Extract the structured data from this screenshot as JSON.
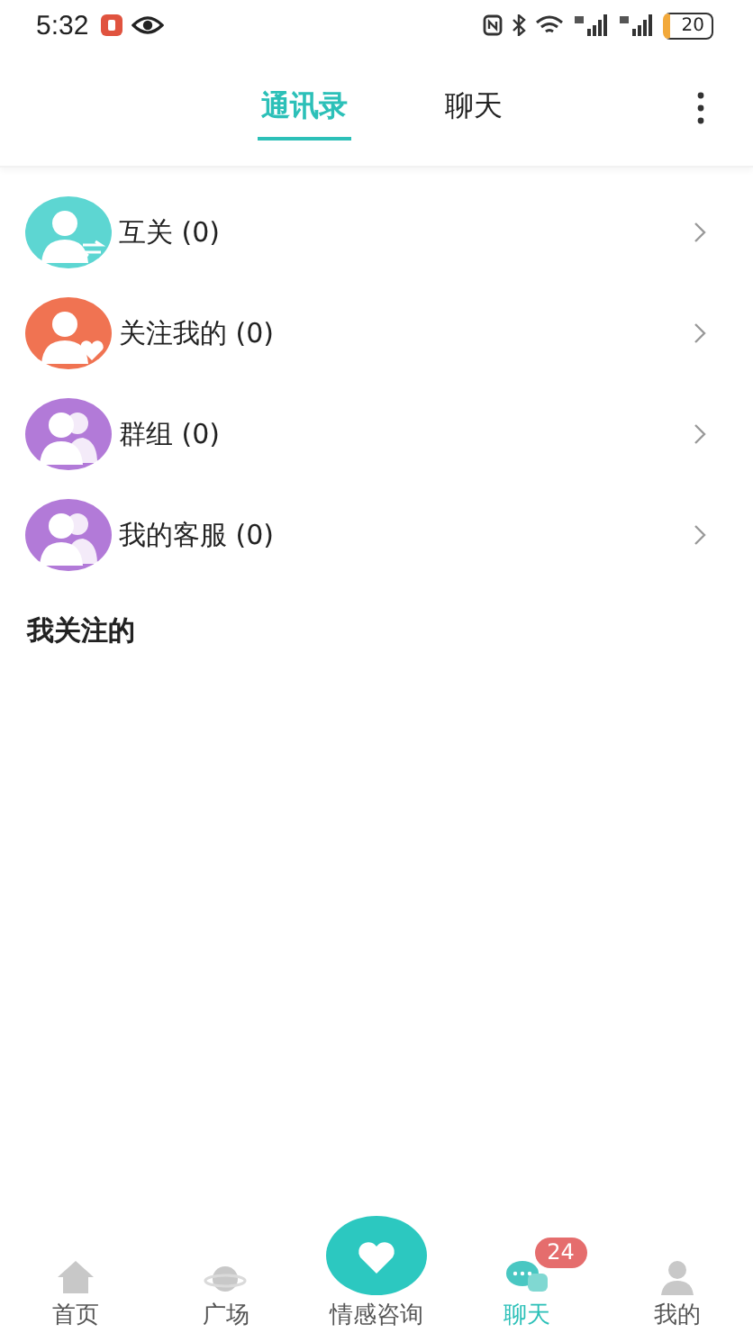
{
  "status_bar": {
    "time": "5:32",
    "battery": "20"
  },
  "tabs": [
    {
      "label": "通讯录",
      "selected": true
    },
    {
      "label": "聊天",
      "selected": false
    }
  ],
  "contacts": [
    {
      "label": "互关 (0)",
      "kind": "mutual",
      "color": "#5dd6d2"
    },
    {
      "label": "关注我的 (0)",
      "kind": "follower",
      "color": "#f07352"
    },
    {
      "label": "群组 (0)",
      "kind": "group",
      "color": "#b27ad8"
    },
    {
      "label": "我的客服 (0)",
      "kind": "group",
      "color": "#b27ad8"
    }
  ],
  "section_title": "我关注的",
  "nav": [
    {
      "label": "首页",
      "kind": "home",
      "selected": false
    },
    {
      "label": "广场",
      "kind": "planet",
      "selected": false
    },
    {
      "label": "情感咨询",
      "kind": "heart",
      "selected": false
    },
    {
      "label": "聊天",
      "kind": "chat",
      "selected": true,
      "badge": "24"
    },
    {
      "label": "我的",
      "kind": "person",
      "selected": false
    }
  ]
}
